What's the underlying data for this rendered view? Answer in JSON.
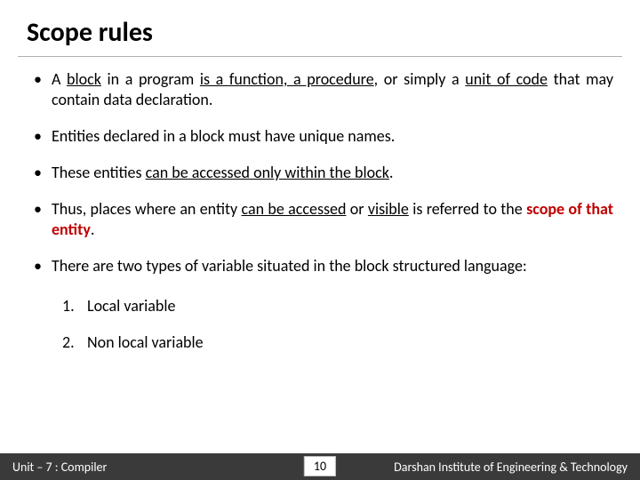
{
  "title": "Scope rules",
  "bullets": {
    "b1": {
      "p1": "A ",
      "p2": "block",
      "p3": " in a program ",
      "p4": "is a function, a procedure",
      "p5": ", or simply a ",
      "p6": "unit of code",
      "p7": " that may contain data declaration."
    },
    "b2": "Entities declared in a block must have unique names.",
    "b3": {
      "p1": "These entities ",
      "p2": "can be accessed only within the block",
      "p3": "."
    },
    "b4": {
      "p1": "Thus, places where an entity ",
      "p2": "can be accessed",
      "p3": " or ",
      "p4": "visible",
      "p5": " is referred to the ",
      "p6": "scope of that entity",
      "p7": "."
    },
    "b5": "There are two types of variable situated in the block structured language:"
  },
  "numbered": {
    "n1": "Local variable",
    "n2": "Non local variable"
  },
  "footer": {
    "left": "Unit – 7 : Compiler",
    "page": "10",
    "right": "Darshan Institute of Engineering & Technology"
  }
}
